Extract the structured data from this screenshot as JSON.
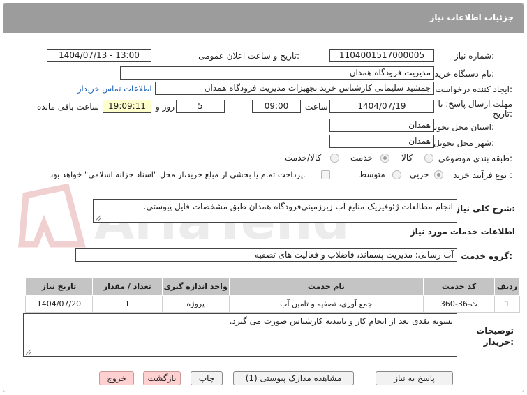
{
  "header": {
    "title": "جزئیات اطلاعات نیاز"
  },
  "need_number": {
    "label": "شماره نیاز:",
    "value": "1104001517000005"
  },
  "announce_datetime": {
    "label": "تاریخ و ساعت اعلان عمومی:",
    "value": "1404/07/13 - 13:00"
  },
  "buyer_org": {
    "label": "نام دستگاه خریدار:",
    "value": "مدیریت فرودگاه همدان"
  },
  "requester": {
    "label": "ایجاد کننده درخواست:",
    "value": "جمشید سلیمانی کارشناس خرید تجهیزات مدیریت فرودگاه همدان",
    "contact_link": "اطلاعات تماس خریدار"
  },
  "deadline": {
    "label_line1": "مهلت ارسال پاسخ: تا",
    "label_line2": "تاریخ:",
    "date": "1404/07/19",
    "time_label": "ساعت",
    "time": "09:00",
    "days": "5",
    "days_label": "روز و",
    "remaining_time": "19:09:11",
    "remaining_label": "ساعت باقی مانده"
  },
  "province": {
    "label": "استان محل تحویل:",
    "value": "همدان"
  },
  "city": {
    "label": "شهر محل تحویل:",
    "value": "همدان"
  },
  "category": {
    "label": "طبقه بندی موضوعی:",
    "options": [
      "کالا",
      "خدمت",
      "کالا/خدمت"
    ],
    "selected": "خدمت"
  },
  "purchase_process": {
    "label": "نوع فرآیند خرید :",
    "options": [
      "جزیی",
      "متوسط"
    ],
    "selected": "جزیی",
    "payment_note": "پرداخت تمام یا بخشی از مبلغ خرید،از محل \"اسناد خزانه اسلامی\" خواهد بود."
  },
  "need_description": {
    "label": "شرح کلی نیاز:",
    "value": "انجام مطالعات ژئوفیزیک منابع آب زیرزمینی‌فرودگاه همدان طبق مشخصات فایل پیوستی."
  },
  "services_section": {
    "title": "اطلاعات خدمات مورد نیاز"
  },
  "service_group": {
    "label": "گروه خدمت:",
    "value": "آب رسانی؛ مدیریت پسماند، فاضلاب و فعالیت های تصفیه"
  },
  "table": {
    "headers": [
      "ردیف",
      "کد خدمت",
      "نام خدمت",
      "واحد اندازه گیری",
      "تعداد / مقدار",
      "تاریخ نیاز"
    ],
    "rows": [
      [
        "1",
        "ث-36-360",
        "جمع آوری، تصفیه و تامین آب",
        "پروژه",
        "1",
        "1404/07/20"
      ]
    ]
  },
  "buyer_notes": {
    "label_line1": "توضیحات",
    "label_line2": "خریدار:",
    "value": "تسویه نقدی بعد از انجام کار و تاییدیه کارشناس صورت می گیرد."
  },
  "buttons": {
    "reply": "پاسخ به نیاز",
    "attachments": "مشاهده مدارک پیوستی (1)",
    "print": "چاپ",
    "back": "بازگشت",
    "exit": "خروج"
  },
  "watermark": {
    "text": "AriaTender.net"
  },
  "colors": {
    "header_bg": "#9c9c9c",
    "table_header_bg": "#c4c4c4",
    "highlight_bg": "#ffffcc",
    "link": "#1a5fb4"
  }
}
